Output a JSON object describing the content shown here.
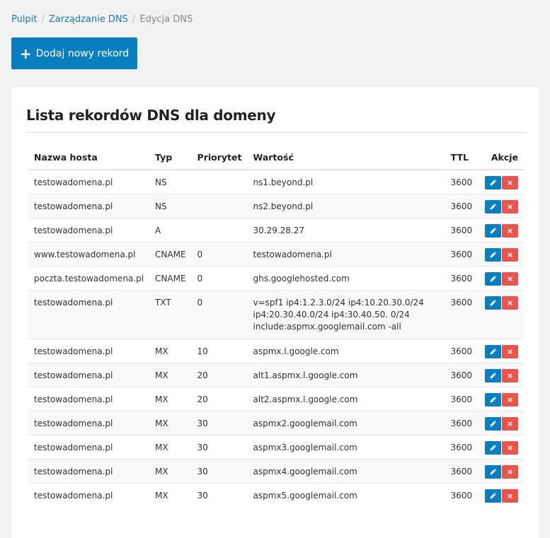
{
  "breadcrumb": {
    "home": "Pulpit",
    "dns_manage": "Zarządzanie DNS",
    "current": "Edycja DNS"
  },
  "add_button": {
    "label": "Dodaj nowy rekord",
    "icon": "plus-icon"
  },
  "panel": {
    "title": "Lista rekordów DNS dla domeny"
  },
  "table": {
    "headers": {
      "host": "Nazwa hosta",
      "type": "Typ",
      "priority": "Priorytet",
      "value": "Wartość",
      "ttl": "TTL",
      "actions": "Akcje"
    },
    "rows": [
      {
        "host": "testowadomena.pl",
        "type": "NS",
        "priority": "",
        "value": "ns1.beyond.pl",
        "ttl": "3600"
      },
      {
        "host": "testowadomena.pl",
        "type": "NS",
        "priority": "",
        "value": "ns2.beyond.pl",
        "ttl": "3600"
      },
      {
        "host": "testowadomena.pl",
        "type": "A",
        "priority": "",
        "value": "30.29.28.27",
        "ttl": "3600"
      },
      {
        "host": "www.testowadomena.pl",
        "type": "CNAME",
        "priority": "0",
        "value": "testowadomena.pl",
        "ttl": "3600"
      },
      {
        "host": "poczta.testowadomena.pl",
        "type": "CNAME",
        "priority": "0",
        "value": "ghs.googlehosted.com",
        "ttl": "3600"
      },
      {
        "host": "testowadomena.pl",
        "type": "TXT",
        "priority": "0",
        "value": "v=spf1 ip4:1.2.3.0/24 ip4:10.20.30.0/24 ip4:20.30.40.0/24 ip4:30.40.50. 0/24 include:aspmx.googlemail.com -all",
        "ttl": "3600"
      },
      {
        "host": "testowadomena.pl",
        "type": "MX",
        "priority": "10",
        "value": "aspmx.l.google.com",
        "ttl": "3600"
      },
      {
        "host": "testowadomena.pl",
        "type": "MX",
        "priority": "20",
        "value": "alt1.aspmx.l.google.com",
        "ttl": "3600"
      },
      {
        "host": "testowadomena.pl",
        "type": "MX",
        "priority": "20",
        "value": "alt2.aspmx.l.google.com",
        "ttl": "3600"
      },
      {
        "host": "testowadomena.pl",
        "type": "MX",
        "priority": "30",
        "value": "aspmx2.googlemail.com",
        "ttl": "3600"
      },
      {
        "host": "testowadomena.pl",
        "type": "MX",
        "priority": "30",
        "value": "aspmx3.googlemail.com",
        "ttl": "3600"
      },
      {
        "host": "testowadomena.pl",
        "type": "MX",
        "priority": "30",
        "value": "aspmx4.googlemail.com",
        "ttl": "3600"
      },
      {
        "host": "testowadomena.pl",
        "type": "MX",
        "priority": "30",
        "value": "aspmx5.googlemail.com",
        "ttl": "3600"
      }
    ],
    "edit_icon": "pencil-icon",
    "delete_label": "×",
    "delete_icon": "close-icon"
  },
  "colors": {
    "primary": "#0a7fbf",
    "danger": "#e8554e",
    "link": "#1e78be",
    "background": "#f1f1f1"
  }
}
